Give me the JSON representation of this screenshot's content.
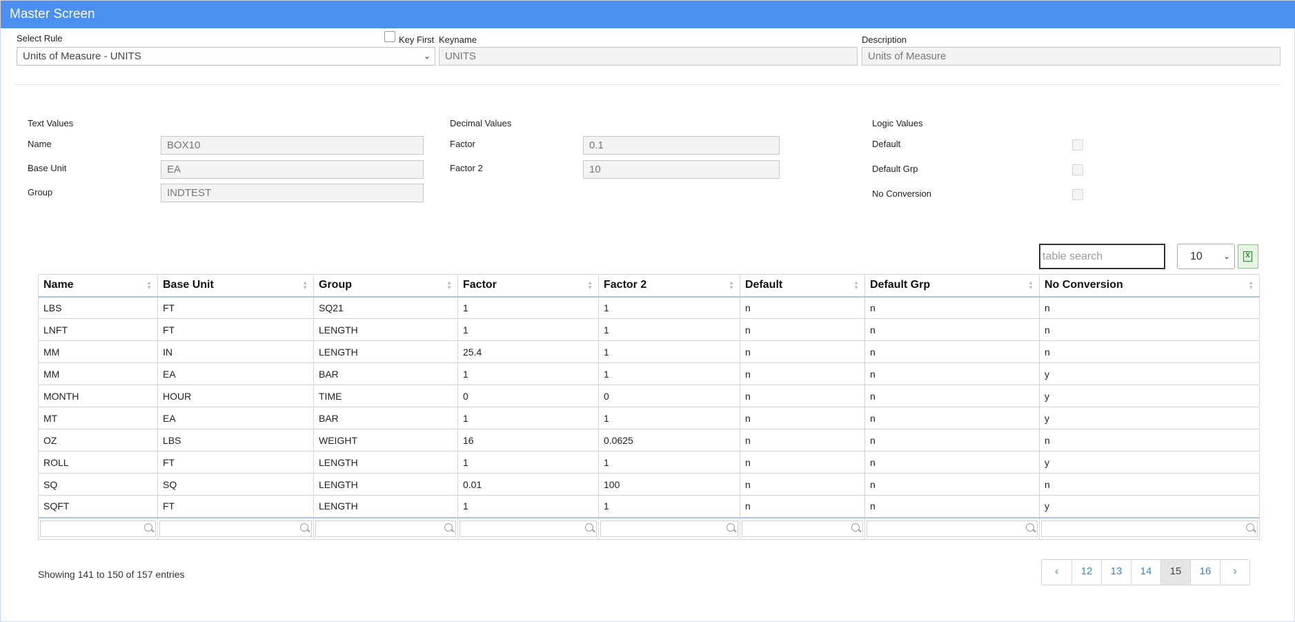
{
  "window": {
    "title": "Master Screen"
  },
  "form": {
    "select_rule_label": "Select Rule",
    "select_rule_value": "Units of Measure - UNITS",
    "key_first_label": "Key First",
    "keyname_label": "Keyname",
    "keyname_value": "UNITS",
    "description_label": "Description",
    "description_value": "Units of Measure"
  },
  "text_values": {
    "heading": "Text Values",
    "name_label": "Name",
    "name_value": "BOX10",
    "base_unit_label": "Base Unit",
    "base_unit_value": "EA",
    "group_label": "Group",
    "group_value": "INDTEST"
  },
  "decimal_values": {
    "heading": "Decimal Values",
    "factor_label": "Factor",
    "factor_value": "0.1",
    "factor2_label": "Factor 2",
    "factor2_value": "10"
  },
  "logic_values": {
    "heading": "Logic Values",
    "default_label": "Default",
    "default_grp_label": "Default Grp",
    "no_conversion_label": "No Conversion"
  },
  "toolbar": {
    "search_placeholder": "table search",
    "page_size": "10",
    "excel_icon": "excel-export-icon"
  },
  "table": {
    "columns": [
      "Name",
      "Base Unit",
      "Group",
      "Factor",
      "Factor 2",
      "Default",
      "Default Grp",
      "No Conversion"
    ],
    "rows": [
      [
        "LBS",
        "FT",
        "SQ21",
        "1",
        "1",
        "n",
        "n",
        "n"
      ],
      [
        "LNFT",
        "FT",
        "LENGTH",
        "1",
        "1",
        "n",
        "n",
        "n"
      ],
      [
        "MM",
        "IN",
        "LENGTH",
        "25.4",
        "1",
        "n",
        "n",
        "n"
      ],
      [
        "MM",
        "EA",
        "BAR",
        "1",
        "1",
        "n",
        "n",
        "y"
      ],
      [
        "MONTH",
        "HOUR",
        "TIME",
        "0",
        "0",
        "n",
        "n",
        "y"
      ],
      [
        "MT",
        "EA",
        "BAR",
        "1",
        "1",
        "n",
        "n",
        "y"
      ],
      [
        "OZ",
        "LBS",
        "WEIGHT",
        "16",
        "0.0625",
        "n",
        "n",
        "n"
      ],
      [
        "ROLL",
        "FT",
        "LENGTH",
        "1",
        "1",
        "n",
        "n",
        "y"
      ],
      [
        "SQ",
        "SQ",
        "LENGTH",
        "0.01",
        "100",
        "n",
        "n",
        "n"
      ],
      [
        "SQFT",
        "FT",
        "LENGTH",
        "1",
        "1",
        "n",
        "n",
        "y"
      ]
    ]
  },
  "footer": {
    "info": "Showing 141 to 150 of 157 entries",
    "pages": [
      "‹",
      "12",
      "13",
      "14",
      "15",
      "16",
      "›"
    ],
    "active_page": "15"
  }
}
